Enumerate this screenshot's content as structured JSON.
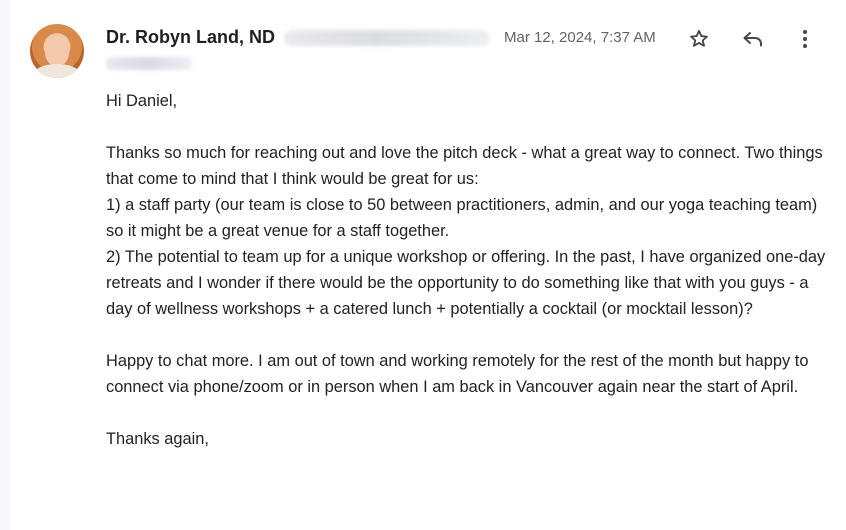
{
  "sender": {
    "name": "Dr. Robyn Land, ND"
  },
  "timestamp": "Mar 12, 2024, 7:37 AM",
  "actions": {
    "star_icon": "star-icon",
    "reply_icon": "reply-icon",
    "more_icon": "more-vert-icon"
  },
  "body": {
    "greeting": "Hi Daniel,",
    "p1": "Thanks so much for reaching out and love the pitch deck - what a great way to connect. Two things that come to mind that I think would be great for us:",
    "item1": "1) a staff party (our team is close to 50 between practitioners, admin, and our yoga teaching team) so it might be a great venue for a staff together.",
    "item2": "2) The potential to team up for a unique workshop or offering. In the past, I have organized one-day retreats and I wonder if there would be the opportunity to do something like that with you guys - a day of wellness workshops + a catered lunch + potentially a cocktail (or mocktail lesson)?",
    "p2": "Happy to chat more. I am out of town and working remotely for the rest of the month but happy to connect via phone/zoom or in person when I am back in Vancouver again near the start of April.",
    "closing": "Thanks again,"
  }
}
